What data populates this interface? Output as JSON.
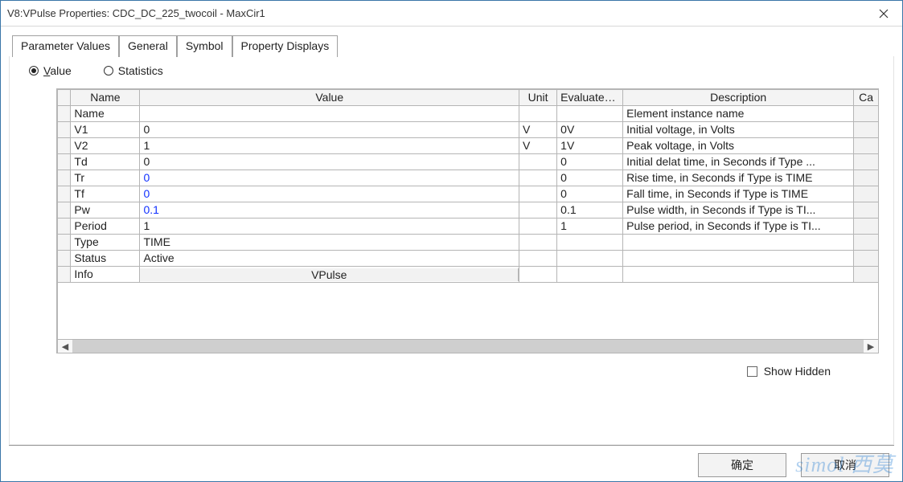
{
  "window": {
    "title": "V8:VPulse Properties: CDC_DC_225_twocoil - MaxCir1"
  },
  "tabs": {
    "items": [
      {
        "label": "Parameter Values",
        "active": true
      },
      {
        "label": "General",
        "active": false
      },
      {
        "label": "Symbol",
        "active": false
      },
      {
        "label": "Property Displays",
        "active": false
      }
    ]
  },
  "radios": {
    "value_label": "Value",
    "value_underline": "V",
    "stats_label": "Statistics",
    "selected": "value"
  },
  "grid": {
    "headers": {
      "name": "Name",
      "value": "Value",
      "unit": "Unit",
      "evaluated": "Evaluated...",
      "description": "Description",
      "callback": "Ca"
    },
    "rows": [
      {
        "name": "Name",
        "value": "",
        "value_blue": false,
        "unit": "",
        "evaluated": "",
        "description": "Element instance name"
      },
      {
        "name": "V1",
        "value": "0",
        "value_blue": false,
        "unit": "V",
        "evaluated": "0V",
        "description": "Initial voltage, in Volts"
      },
      {
        "name": "V2",
        "value": "1",
        "value_blue": false,
        "unit": "V",
        "evaluated": "1V",
        "description": "Peak voltage, in Volts"
      },
      {
        "name": "Td",
        "value": "0",
        "value_blue": false,
        "unit": "",
        "evaluated": "0",
        "description": "Initial delat time, in Seconds if Type ..."
      },
      {
        "name": "Tr",
        "value": "0",
        "value_blue": true,
        "unit": "",
        "evaluated": "0",
        "description": "Rise time, in Seconds if Type is TIME"
      },
      {
        "name": "Tf",
        "value": "0",
        "value_blue": true,
        "unit": "",
        "evaluated": "0",
        "description": "Fall time, in Seconds if Type is TIME"
      },
      {
        "name": "Pw",
        "value": "0.1",
        "value_blue": true,
        "unit": "",
        "evaluated": "0.1",
        "description": "Pulse width, in Seconds if Type is TI..."
      },
      {
        "name": "Period",
        "value": "1",
        "value_blue": false,
        "unit": "",
        "evaluated": "1",
        "description": "Pulse period, in Seconds if Type is TI..."
      },
      {
        "name": "Type",
        "value": "TIME",
        "value_blue": false,
        "unit": "",
        "evaluated": "",
        "description": ""
      },
      {
        "name": "Status",
        "value": "Active",
        "value_blue": false,
        "unit": "",
        "evaluated": "",
        "description": ""
      },
      {
        "name": "Info",
        "value": "VPulse",
        "value_blue": false,
        "is_button": true,
        "unit": "",
        "evaluated": "",
        "description": ""
      }
    ]
  },
  "show_hidden": {
    "label": "Show Hidden",
    "checked": false
  },
  "footer": {
    "ok_label": "确定",
    "cancel_label": "取消"
  },
  "watermark": "simol 西莫"
}
